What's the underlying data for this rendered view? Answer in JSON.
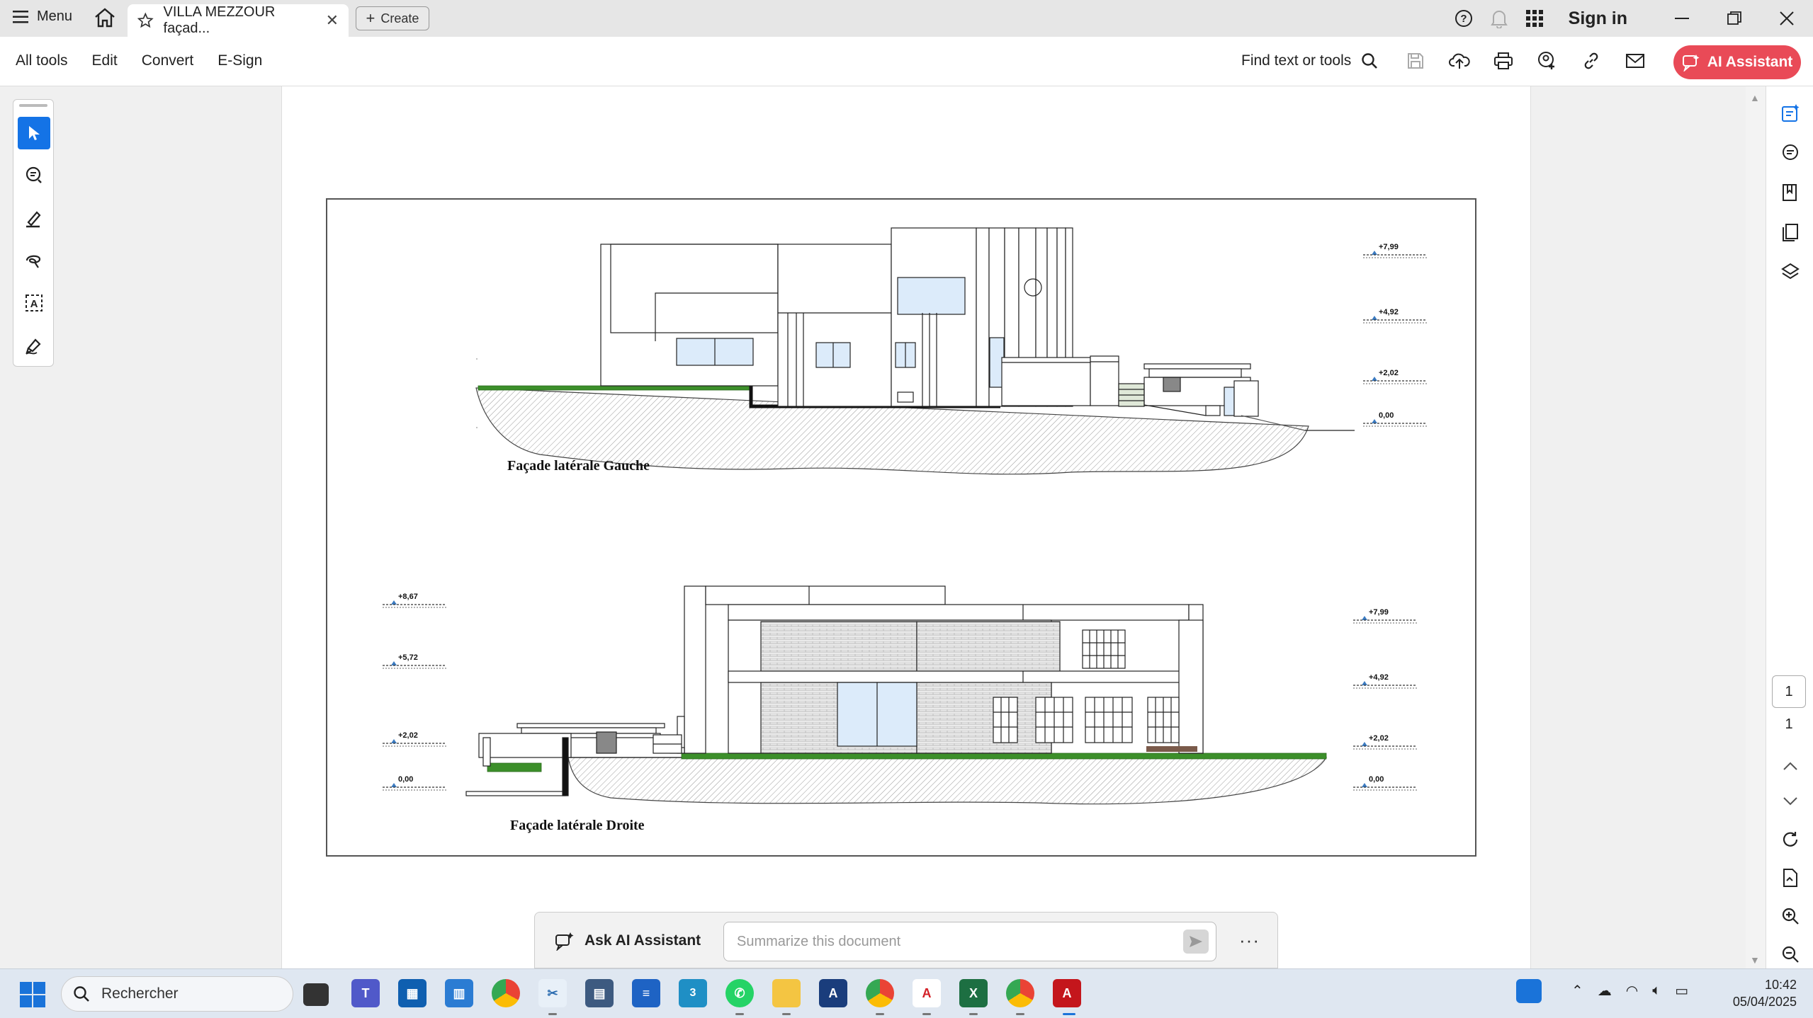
{
  "titlebar": {
    "menu_label": "Menu",
    "tab_title": "VILLA MEZZOUR façad...",
    "create_label": "Create",
    "signin_label": "Sign in"
  },
  "menubar": {
    "items": [
      "All tools",
      "Edit",
      "Convert",
      "E-Sign"
    ],
    "find_label": "Find text or tools",
    "ai_button_label": "AI Assistant"
  },
  "tools": [
    "select-tool",
    "comment-tool",
    "highlight-tool",
    "draw-tool",
    "text-select-tool",
    "sign-tool"
  ],
  "document": {
    "top_title": "Façade latérale Gauche",
    "bottom_title": "Façade latérale Droite",
    "top_levels": [
      "+7,99",
      "+4,92",
      "+2,02",
      "0,00"
    ],
    "bottom_left_levels": [
      "+8,67",
      "+5,72",
      "+2,02",
      "0,00"
    ],
    "bottom_right_levels": [
      "+7,99",
      "+4,92",
      "+2,02",
      "0,00"
    ]
  },
  "navigation": {
    "current_page": "1",
    "total_pages": "1"
  },
  "assistant_bar": {
    "label": "Ask AI Assistant",
    "placeholder": "Summarize this document",
    "more": "···"
  },
  "taskbar": {
    "search_placeholder": "Rechercher",
    "time": "10:42",
    "date": "05/04/2025"
  },
  "colors": {
    "accent_blue": "#1473e6",
    "ai_red": "#e94a57",
    "grass_green": "#3c8f2a",
    "glass_blue": "#dcebfa"
  }
}
